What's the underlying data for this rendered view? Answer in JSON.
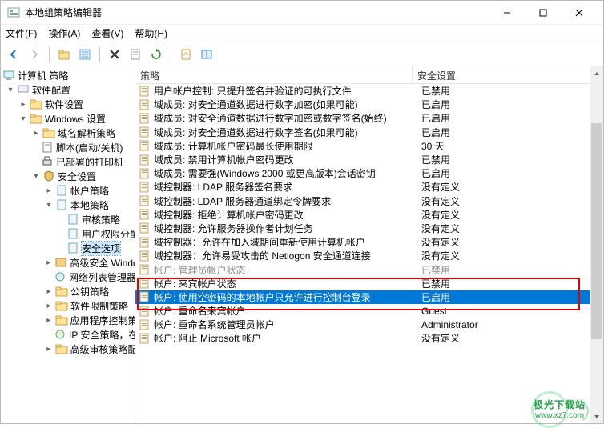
{
  "window": {
    "title": "本地组策略编辑器"
  },
  "menu": {
    "file": "文件(F)",
    "action": "操作(A)",
    "view": "查看(V)",
    "help": "帮助(H)"
  },
  "tree": {
    "root": "计算机 策略",
    "n0": "软件配置",
    "n1": "软件设置",
    "n2": "Windows 设置",
    "n2_0": "域名解析策略",
    "n2_1": "脚本(启动/关机)",
    "n2_2": "已部署的打印机",
    "n2_3": "安全设置",
    "n2_3_0": "帐户策略",
    "n2_3_1": "本地策略",
    "n2_3_1_0": "审核策略",
    "n2_3_1_1": "用户权限分配",
    "n2_3_1_2": "安全选项",
    "n2_3_2": "高级安全 Windo",
    "n2_3_3": "网络列表管理器",
    "n2_3_4": "公钥策略",
    "n2_3_5": "软件限制策略",
    "n2_3_6": "应用程序控制策",
    "n2_3_7": "IP 安全策略，在",
    "n2_3_8": "高级审核策略配"
  },
  "columns": {
    "c1": "策略",
    "c2": "安全设置"
  },
  "rows": [
    {
      "name": "用户帐户控制: 只提升签名并验证的可执行文件",
      "val": "已禁用"
    },
    {
      "name": "域成员: 对安全通道数据进行数字加密(如果可能)",
      "val": "已启用"
    },
    {
      "name": "域成员: 对安全通道数据进行数字加密或数字签名(始终)",
      "val": "已启用"
    },
    {
      "name": "域成员: 对安全通道数据进行数字签名(如果可能)",
      "val": "已启用"
    },
    {
      "name": "域成员: 计算机帐户密码最长使用期限",
      "val": "30 天"
    },
    {
      "name": "域成员: 禁用计算机帐户密码更改",
      "val": "已禁用"
    },
    {
      "name": "域成员: 需要强(Windows 2000 或更高版本)会话密钥",
      "val": "已启用"
    },
    {
      "name": "域控制器: LDAP 服务器签名要求",
      "val": "没有定义"
    },
    {
      "name": "域控制器: LDAP 服务器通道绑定令牌要求",
      "val": "没有定义"
    },
    {
      "name": "域控制器: 拒绝计算机帐户密码更改",
      "val": "没有定义"
    },
    {
      "name": "域控制器: 允许服务器操作者计划任务",
      "val": "没有定义"
    },
    {
      "name": "域控制器：允许在加入域期间重新使用计算机帐户",
      "val": "没有定义"
    },
    {
      "name": "域控制器：允许易受攻击的 Netlogon 安全通道连接",
      "val": "没有定义"
    },
    {
      "name": "帐户: 管理员帐户状态",
      "val": "已禁用",
      "dim": true
    },
    {
      "name": "帐户: 来宾帐户状态",
      "val": "已禁用"
    },
    {
      "name": "帐户: 使用空密码的本地帐户只允许进行控制台登录",
      "val": "已启用",
      "sel": true
    },
    {
      "name": "帐户: 重命名来宾帐户",
      "val": "Guest"
    },
    {
      "name": "帐户: 重命名系统管理员帐户",
      "val": "Administrator"
    },
    {
      "name": "帐户: 阻止 Microsoft 帐户",
      "val": "没有定义"
    }
  ],
  "watermark": {
    "line1": "极光下载站",
    "line2": "www.xz7.com"
  }
}
